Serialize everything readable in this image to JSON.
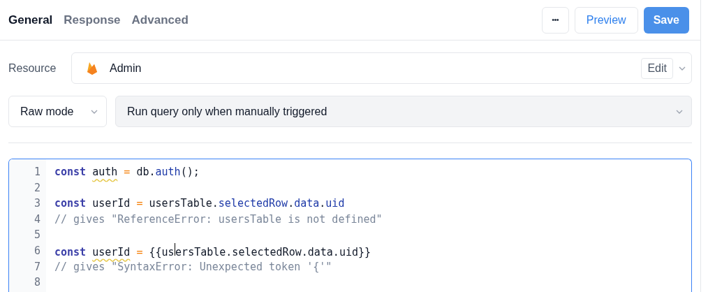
{
  "tabs": [
    {
      "label": "General",
      "selected": true
    },
    {
      "label": "Response",
      "selected": false
    },
    {
      "label": "Advanced",
      "selected": false
    }
  ],
  "toolbar": {
    "more": "•••",
    "preview": "Preview",
    "save": "Save"
  },
  "resource": {
    "label": "Resource",
    "value": "Admin",
    "edit": "Edit"
  },
  "mode": {
    "value": "Raw mode"
  },
  "trigger": {
    "value": "Run query only when manually triggered"
  },
  "editor": {
    "focused": true,
    "lines": [
      {
        "number": "1",
        "tokens": [
          {
            "kind": "keyword",
            "text": "const "
          },
          {
            "kind": "plain",
            "text": "auth",
            "warning": true
          },
          {
            "kind": "operator",
            "text": " = "
          },
          {
            "kind": "plain",
            "text": "db."
          },
          {
            "kind": "property",
            "text": "auth"
          },
          {
            "kind": "plain",
            "text": "();"
          }
        ]
      },
      {
        "number": "2"
      },
      {
        "number": "3",
        "tokens": [
          {
            "kind": "keyword",
            "text": "const"
          },
          {
            "kind": "plain",
            "text": " userId "
          },
          {
            "kind": "operator",
            "text": "="
          },
          {
            "kind": "plain",
            "text": " usersTable."
          },
          {
            "kind": "property",
            "text": "selectedRow"
          },
          {
            "kind": "plain",
            "text": "."
          },
          {
            "kind": "property",
            "text": "data"
          },
          {
            "kind": "plain",
            "text": "."
          },
          {
            "kind": "property",
            "text": "uid"
          }
        ]
      },
      {
        "number": "4",
        "tokens": [
          {
            "kind": "comment",
            "text": "// gives \"ReferenceError: usersTable is not defined\""
          }
        ]
      },
      {
        "number": "5"
      },
      {
        "number": "6",
        "tokens": [
          {
            "kind": "keyword",
            "text": "const "
          },
          {
            "kind": "plain",
            "text": "userId",
            "warning": true
          },
          {
            "kind": "operator",
            "text": " = "
          },
          {
            "kind": "plain",
            "text": "{{us",
            "cursor": true
          },
          {
            "kind": "plain",
            "text": "ersTable.selectedRow.data.uid}}"
          }
        ]
      },
      {
        "number": "7",
        "tokens": [
          {
            "kind": "comment",
            "text": "// gives \"SyntaxError: Unexpected token '{'\""
          }
        ]
      },
      {
        "number": "8"
      }
    ]
  }
}
